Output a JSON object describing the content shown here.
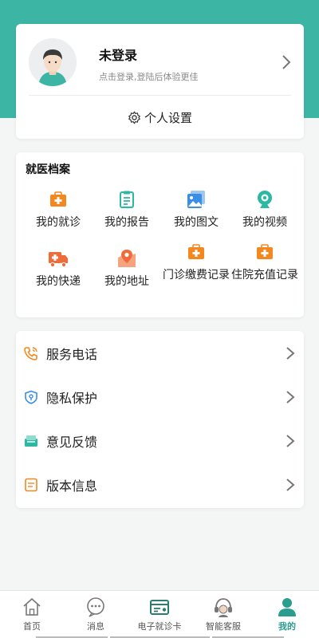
{
  "profile": {
    "title": "未登录",
    "subtitle": "点击登录,登陆后体验更佳",
    "settings_label": "个人设置"
  },
  "records": {
    "title": "就医档案",
    "items": [
      {
        "label": "我的就诊",
        "icon": "medical-kit-icon",
        "color": "#f5871f"
      },
      {
        "label": "我的报告",
        "icon": "report-clipboard-icon",
        "color": "#2cb8a2"
      },
      {
        "label": "我的图文",
        "icon": "image-gallery-icon",
        "color": "#3a8ee6"
      },
      {
        "label": "我的视频",
        "icon": "webcam-icon",
        "color": "#2cb8a2"
      },
      {
        "label": "我的快递",
        "icon": "delivery-truck-icon",
        "color": "#f06b3a"
      },
      {
        "label": "我的地址",
        "icon": "location-pin-icon",
        "color": "#f06b3a"
      },
      {
        "label": "门诊缴费记录",
        "icon": "medical-kit-icon",
        "color": "#f5871f"
      },
      {
        "label": "住院充值记录",
        "icon": "medical-kit-icon",
        "color": "#f5871f"
      }
    ]
  },
  "menu": [
    {
      "label": "服务电话",
      "icon": "phone-icon",
      "color": "#f5871f"
    },
    {
      "label": "隐私保护",
      "icon": "shield-icon",
      "color": "#3a8ee6"
    },
    {
      "label": "意见反馈",
      "icon": "feedback-icon",
      "color": "#2cb8a2"
    },
    {
      "label": "版本信息",
      "icon": "document-icon",
      "color": "#f5871f"
    }
  ],
  "tabs": [
    {
      "label": "首页",
      "icon": "home-icon"
    },
    {
      "label": "消息",
      "icon": "message-icon"
    },
    {
      "label": "电子就诊卡",
      "icon": "card-icon"
    },
    {
      "label": "智能客服",
      "icon": "headset-icon"
    },
    {
      "label": "我的",
      "icon": "person-icon",
      "active": true
    }
  ],
  "colors": {
    "accent": "#3db5a5",
    "active_tab": "#2a9d8f"
  }
}
